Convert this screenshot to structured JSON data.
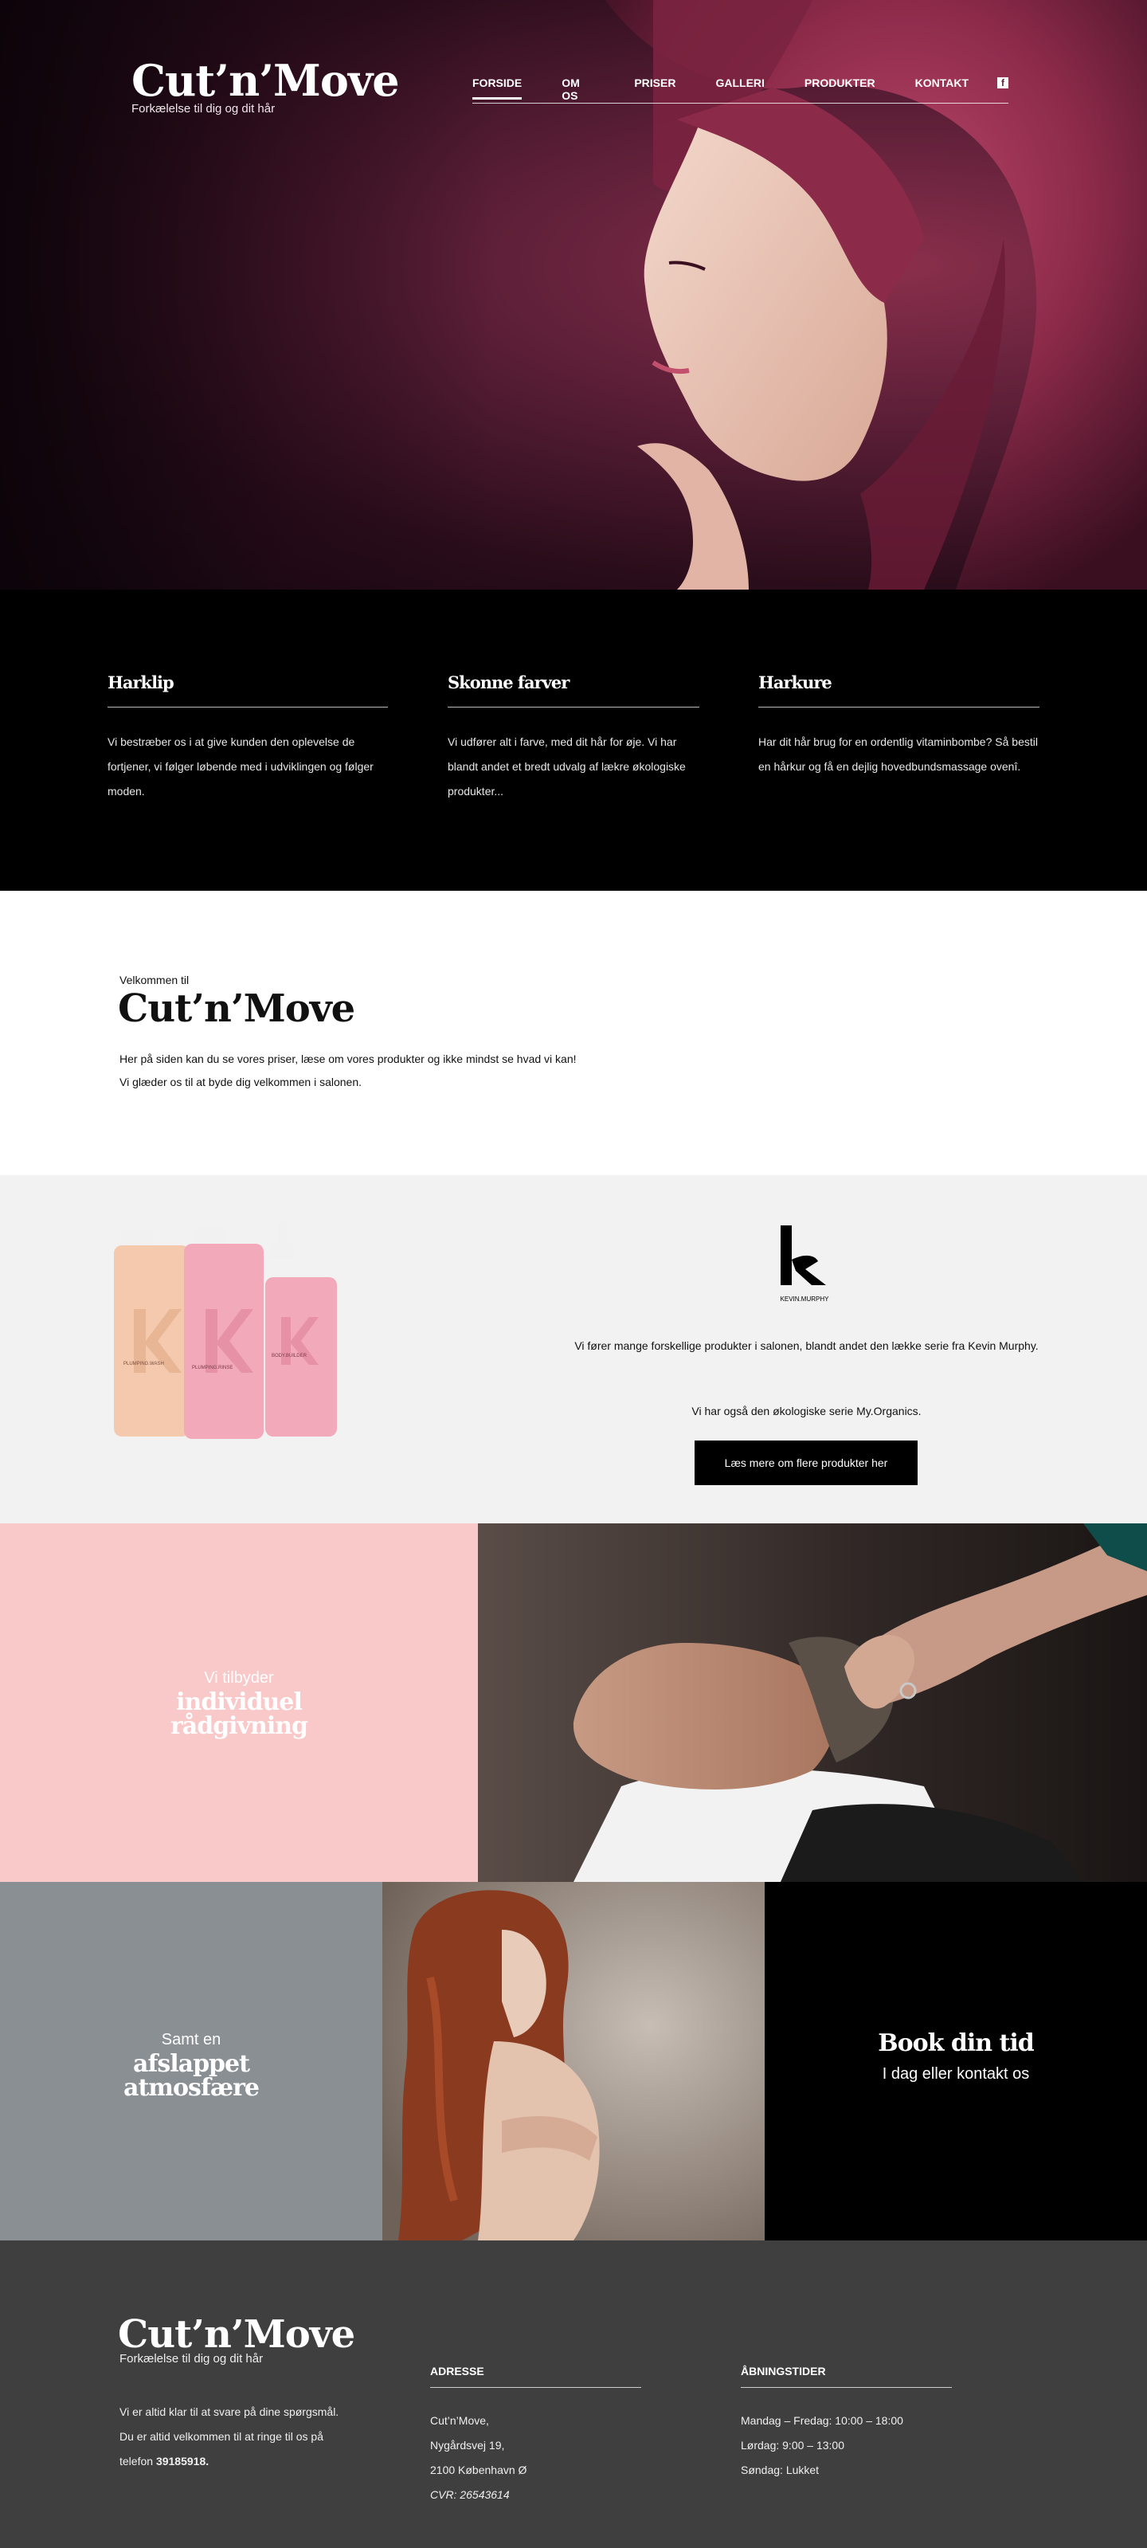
{
  "brand": {
    "name": "Cut’n’Move",
    "tagline": "Forkælelse til dig og dit hår"
  },
  "nav": {
    "items": [
      {
        "label": "FORSIDE",
        "active": true
      },
      {
        "label": "OM OS",
        "active": false
      },
      {
        "label": "PRISER",
        "active": false
      },
      {
        "label": "GALLERI",
        "active": false
      },
      {
        "label": "PRODUKTER",
        "active": false
      },
      {
        "label": "KONTAKT",
        "active": false
      }
    ],
    "social_icon": "facebook-icon"
  },
  "services": [
    {
      "title": "Harklip",
      "text": "Vi bestræber os i at give kunden den oplevelse de fortjener, vi følger løbende med i udviklingen og følger moden."
    },
    {
      "title": "Skonne farver",
      "text": "Vi udfører alt i farve, med dit hår for øje. Vi har blandt andet et bredt udvalg af lækre økologiske produkter..."
    },
    {
      "title": "Harkure",
      "text": "Har dit hår brug for en ordentlig vitaminbombe? Så bestil en hårkur og få en dejlig hovedbundsmassage ovenî."
    }
  ],
  "welcome": {
    "kicker": "Velkommen til",
    "title": "Cut’n’Move",
    "p1": "Her på siden kan du se vores priser, læse om vores produkter og ikke mindst se hvad vi kan!",
    "p2": "Vi glæder os til at byde dig velkommen i salonen."
  },
  "products": {
    "brand_logo_text": "KEVIN.MURPHY",
    "text1": "Vi fører mange forskellige produkter i salonen, blandt andet den lække serie fra Kevin Murphy.",
    "text2": "Vi har også den økologiske serie My.Organics.",
    "button": "Læs mere om flere produkter her",
    "bottle_labels": [
      "PLUMPING.WASH",
      "PLUMPING.RINSE",
      "BODY.BUILDER"
    ]
  },
  "advice": {
    "kicker": "Vi tilbyder",
    "title_line1": "individuel",
    "title_line2": "rådgivning"
  },
  "atmosphere": {
    "kicker": "Samt en",
    "title_line1": "afslappet",
    "title_line2": "atmosfære"
  },
  "booking": {
    "title": "Book din tid",
    "subtitle": "I dag eller kontakt os"
  },
  "footer": {
    "name": "Cut’n’Move",
    "tagline": "Forkælelse til dig og dit hår",
    "text_prefix": "Vi er altid klar til at svare på dine spørgsmål. Du er altid velkommen til at ringe til os på telefon",
    "phone": "39185918.",
    "address_title": "ADRESSE",
    "address_lines": [
      "Cut’n’Move,",
      "Nygårdsvej 19,",
      "2100 København Ø"
    ],
    "cvr": "CVR: 26543614",
    "hours_title": "ÅBNINGSTIDER",
    "hours": [
      "Mandag – Fredag: 10:00 – 18:00",
      "Lørdag: 9:00 – 13:00",
      "Søndag: Lukket"
    ]
  },
  "colors": {
    "hero_hair": "#8a2f4c",
    "pink_panel": "#f9c8c9",
    "grey_panel": "#8a8f94",
    "footer_bg": "#3f3f3f",
    "products_bg": "#f2f2f2"
  }
}
